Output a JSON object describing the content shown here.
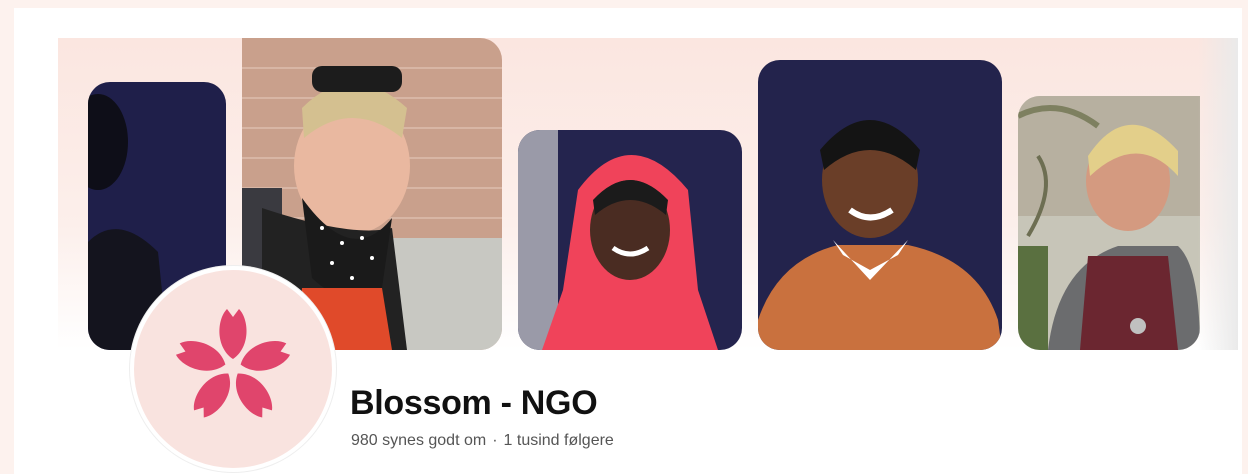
{
  "page": {
    "name": "Blossom - NGO",
    "likes": "980 synes godt om",
    "separator": "·",
    "followers": "1 tusind følgere"
  },
  "cover": {
    "photos": [
      {
        "subject": "person-dark-background"
      },
      {
        "subject": "smiling-woman-sunglasses-brick-wall"
      },
      {
        "subject": "smiling-woman-red-headscarf"
      },
      {
        "subject": "smiling-woman-orange-sweater"
      },
      {
        "subject": "woman-maroon-shirt-outdoors"
      }
    ]
  },
  "icons": {
    "logo": "cherry-blossom-icon"
  },
  "colors": {
    "cover_background": "#fbe6e0",
    "logo_petal": "#e0456c",
    "avatar_background": "#f9e3df",
    "photo_backdrop": "#26254f"
  }
}
